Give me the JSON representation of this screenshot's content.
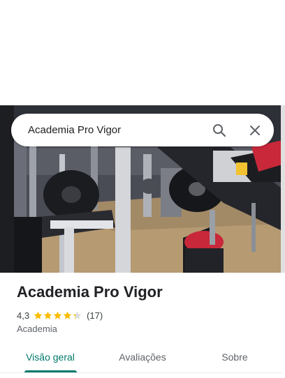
{
  "colors": {
    "accent": "#00796b",
    "star": "#fbbc04",
    "star_empty": "#dadce0",
    "text_primary": "#202124",
    "text_secondary": "#5f6368"
  },
  "search": {
    "query": "Academia Pro Vigor",
    "search_icon": "search-icon",
    "close_icon": "close-icon"
  },
  "hero": {
    "image": "gym-interior-photo"
  },
  "place": {
    "name": "Academia Pro Vigor",
    "rating_value": "4,3",
    "rating": 4.3,
    "stars_max": 5,
    "review_count": "(17)",
    "category": "Academia"
  },
  "tabs": [
    {
      "label": "Visão geral",
      "active": true
    },
    {
      "label": "Avaliações",
      "active": false
    },
    {
      "label": "Sobre",
      "active": false
    }
  ]
}
